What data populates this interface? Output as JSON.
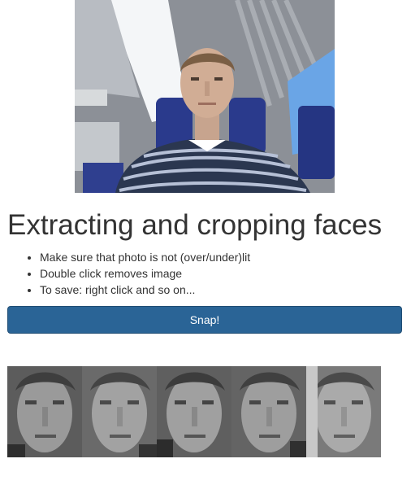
{
  "page": {
    "title": "Extracting and cropping faces",
    "tips": [
      "Make sure that photo is not (over/under)lit",
      "Double click removes image",
      "To save: right click and so on..."
    ],
    "snap_label": "Snap!"
  },
  "thumbnails": [
    {
      "shade": "#5c5c5c"
    },
    {
      "shade": "#6a6a6a"
    },
    {
      "shade": "#5f5f5f"
    },
    {
      "shade": "#646464"
    },
    {
      "shade": "#7a7a7a"
    }
  ],
  "colors": {
    "button_bg": "#2a6496",
    "button_text": "#ffffff",
    "text": "#333333"
  }
}
